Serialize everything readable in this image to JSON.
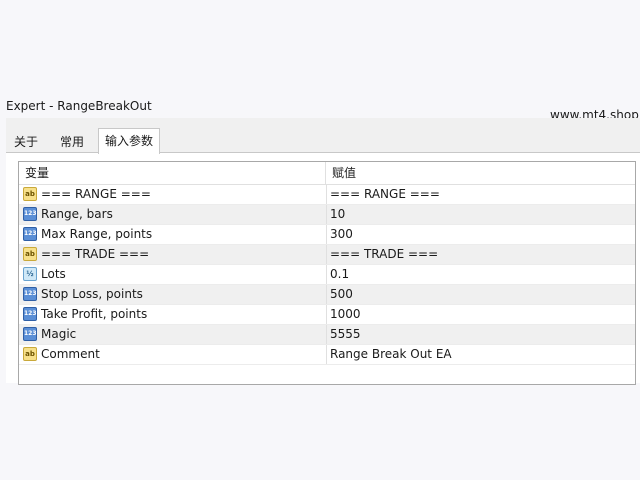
{
  "window": {
    "title": "Expert - RangeBreakOut"
  },
  "watermark": "www.mt4.shop",
  "tabs": [
    {
      "label": "关于",
      "active": false
    },
    {
      "label": "常用",
      "active": false
    },
    {
      "label": "输入参数",
      "active": true
    }
  ],
  "grid": {
    "columns": [
      "变量",
      "赋值"
    ],
    "rows": [
      {
        "type": "string",
        "icon": "ab",
        "variable": "=== RANGE ===",
        "value": "=== RANGE ==="
      },
      {
        "type": "int",
        "icon": "123",
        "variable": "Range, bars",
        "value": "10"
      },
      {
        "type": "int",
        "icon": "123",
        "variable": "Max Range, points",
        "value": "300"
      },
      {
        "type": "string",
        "icon": "ab",
        "variable": "=== TRADE ===",
        "value": "=== TRADE ==="
      },
      {
        "type": "double",
        "icon": "½",
        "variable": "Lots",
        "value": "0.1"
      },
      {
        "type": "int",
        "icon": "123",
        "variable": "Stop Loss, points",
        "value": "500"
      },
      {
        "type": "int",
        "icon": "123",
        "variable": "Take Profit, points",
        "value": "1000"
      },
      {
        "type": "int",
        "icon": "123",
        "variable": "Magic",
        "value": "5555"
      },
      {
        "type": "string",
        "icon": "ab",
        "variable": "Comment",
        "value": "Range Break Out EA"
      }
    ]
  }
}
